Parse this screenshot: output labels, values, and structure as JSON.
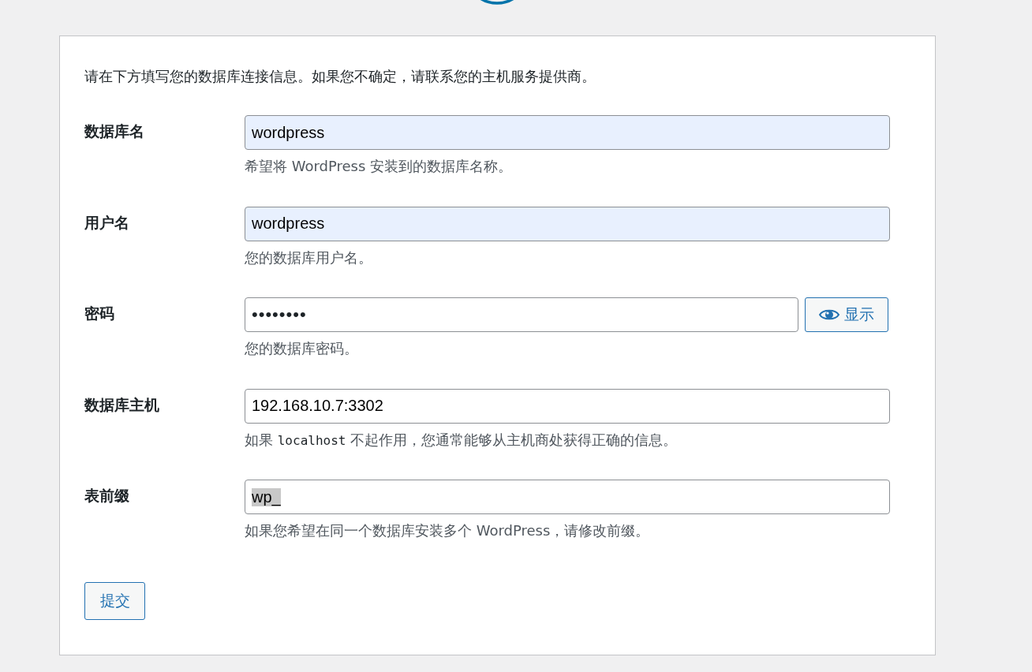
{
  "intro": "请在下方填写您的数据库连接信息。如果您不确定，请联系您的主机服务提供商。",
  "fields": [
    {
      "label": "数据库名",
      "kind": "text",
      "value": "wordpress",
      "autofilled": true,
      "text_selected": false,
      "hint": [
        {
          "kind": "text",
          "text": "希望将 WordPress 安装到的数据库名称。"
        }
      ]
    },
    {
      "label": "用户名",
      "kind": "text",
      "value": "wordpress",
      "autofilled": true,
      "text_selected": false,
      "hint": [
        {
          "kind": "text",
          "text": "您的数据库用户名。"
        }
      ]
    },
    {
      "label": "密码",
      "kind": "password",
      "value": "••••••••",
      "autofilled": false,
      "text_selected": false,
      "toggle_label": "显示",
      "hint": [
        {
          "kind": "text",
          "text": "您的数据库密码。"
        }
      ]
    },
    {
      "label": "数据库主机",
      "kind": "text",
      "value": "192.168.10.7:3302",
      "autofilled": false,
      "text_selected": false,
      "hint": [
        {
          "kind": "text",
          "text": "如果 "
        },
        {
          "kind": "code",
          "text": "localhost"
        },
        {
          "kind": "text",
          "text": " 不起作用，您通常能够从主机商处获得正确的信息。"
        }
      ]
    },
    {
      "label": "表前缀",
      "kind": "text",
      "value": "wp_",
      "autofilled": false,
      "text_selected": true,
      "hint": [
        {
          "kind": "text",
          "text": "如果您希望在同一个数据库安装多个 WordPress，请修改前缀。"
        }
      ]
    }
  ],
  "submit": "提交"
}
